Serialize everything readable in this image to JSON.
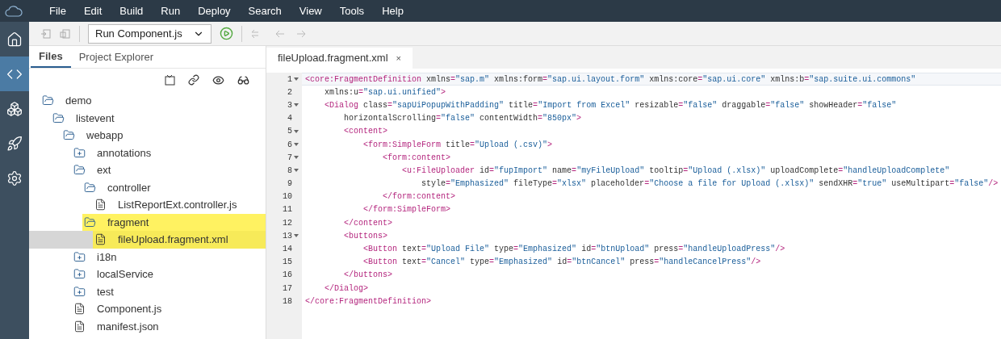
{
  "menu_bar": {
    "items": [
      "File",
      "Edit",
      "Build",
      "Run",
      "Deploy",
      "Search",
      "View",
      "Tools",
      "Help"
    ]
  },
  "sidebar": {
    "items": [
      {
        "kind": "home",
        "selected": false
      },
      {
        "kind": "code",
        "selected": true
      },
      {
        "kind": "cube",
        "selected": false
      },
      {
        "kind": "rocket",
        "selected": false
      },
      {
        "kind": "settings",
        "selected": false
      }
    ]
  },
  "toolbar": {
    "run_configuration": "Run Component.js"
  },
  "panel_tabs": [
    {
      "label": "Files",
      "selected": true
    },
    {
      "label": "Project Explorer",
      "selected": false
    }
  ],
  "file_tree": [
    {
      "name": "demo",
      "kind": "folder",
      "expanded": true,
      "selected": false,
      "highlighted": false,
      "children": [
        {
          "name": "listevent",
          "kind": "folder",
          "expanded": true,
          "selected": false,
          "highlighted": false,
          "children": [
            {
              "name": "webapp",
              "kind": "folder",
              "expanded": true,
              "selected": false,
              "highlighted": false,
              "children": [
                {
                  "name": "annotations",
                  "kind": "folder",
                  "expanded": false,
                  "selected": false,
                  "highlighted": false
                },
                {
                  "name": "ext",
                  "kind": "folder",
                  "expanded": true,
                  "selected": false,
                  "highlighted": false,
                  "children": [
                    {
                      "name": "controller",
                      "kind": "folder",
                      "expanded": true,
                      "selected": false,
                      "highlighted": false,
                      "children": [
                        {
                          "name": "ListReportExt.controller.js",
                          "kind": "file",
                          "selected": false,
                          "highlighted": false
                        }
                      ]
                    },
                    {
                      "name": "fragment",
                      "kind": "folder",
                      "expanded": true,
                      "selected": false,
                      "highlighted": true,
                      "children": [
                        {
                          "name": "fileUpload.fragment.xml",
                          "kind": "file",
                          "selected": true,
                          "highlighted": true
                        }
                      ]
                    }
                  ]
                },
                {
                  "name": "i18n",
                  "kind": "folder",
                  "expanded": false,
                  "selected": false,
                  "highlighted": false
                },
                {
                  "name": "localService",
                  "kind": "folder",
                  "expanded": false,
                  "selected": false,
                  "highlighted": false
                },
                {
                  "name": "test",
                  "kind": "folder",
                  "expanded": false,
                  "selected": false,
                  "highlighted": false
                },
                {
                  "name": "Component.js",
                  "kind": "file",
                  "selected": false,
                  "highlighted": false
                },
                {
                  "name": "manifest.json",
                  "kind": "file",
                  "selected": false,
                  "highlighted": false
                }
              ]
            }
          ]
        }
      ]
    }
  ],
  "editor": {
    "tabs": [
      {
        "label": "fileUpload.fragment.xml",
        "selected": true,
        "close": "×"
      }
    ],
    "lines": [
      {
        "number": "1",
        "foldable": true,
        "current": true,
        "text": "<core:FragmentDefinition xmlns=\"sap.m\" xmlns:form=\"sap.ui.layout.form\" xmlns:core=\"sap.ui.core\" xmlns:b=\"sap.suite.ui.commons\""
      },
      {
        "number": "2",
        "foldable": false,
        "current": false,
        "text": "    xmlns:u=\"sap.ui.unified\">"
      },
      {
        "number": "3",
        "foldable": true,
        "current": false,
        "text": "    <Dialog class=\"sapUiPopupWithPadding\" title=\"Import from Excel\" resizable=\"false\" draggable=\"false\" showHeader=\"false\""
      },
      {
        "number": "4",
        "foldable": false,
        "current": false,
        "text": "        horizontalScrolling=\"false\" contentWidth=\"850px\">"
      },
      {
        "number": "5",
        "foldable": true,
        "current": false,
        "text": "        <content>"
      },
      {
        "number": "6",
        "foldable": true,
        "current": false,
        "text": "            <form:SimpleForm title=\"Upload (.csv)\">"
      },
      {
        "number": "7",
        "foldable": true,
        "current": false,
        "text": "                <form:content>"
      },
      {
        "number": "8",
        "foldable": true,
        "current": false,
        "text": "                    <u:FileUploader id=\"fupImport\" name=\"myFileUpload\" tooltip=\"Upload (.xlsx)\" uploadComplete=\"handleUploadComplete\""
      },
      {
        "number": "9",
        "foldable": false,
        "current": false,
        "text": "                        style=\"Emphasized\" fileType=\"xlsx\" placeholder=\"Choose a file for Upload (.xlsx)\" sendXHR=\"true\" useMultipart=\"false\"/>"
      },
      {
        "number": "10",
        "foldable": false,
        "current": false,
        "text": "                </form:content>"
      },
      {
        "number": "11",
        "foldable": false,
        "current": false,
        "text": "            </form:SimpleForm>"
      },
      {
        "number": "12",
        "foldable": false,
        "current": false,
        "text": "        </content>"
      },
      {
        "number": "13",
        "foldable": true,
        "current": false,
        "text": "        <buttons>"
      },
      {
        "number": "14",
        "foldable": false,
        "current": false,
        "text": "            <Button text=\"Upload File\" type=\"Emphasized\" id=\"btnUpload\" press=\"handleUploadPress\"/>"
      },
      {
        "number": "15",
        "foldable": false,
        "current": false,
        "text": "            <Button text=\"Cancel\" type=\"Emphasized\" id=\"btnCancel\" press=\"handleCancelPress\"/>"
      },
      {
        "number": "16",
        "foldable": false,
        "current": false,
        "text": "        </buttons>"
      },
      {
        "number": "17",
        "foldable": false,
        "current": false,
        "text": "    </Dialog>"
      },
      {
        "number": "18",
        "foldable": false,
        "current": false,
        "text": "</core:FragmentDefinition>"
      }
    ]
  }
}
